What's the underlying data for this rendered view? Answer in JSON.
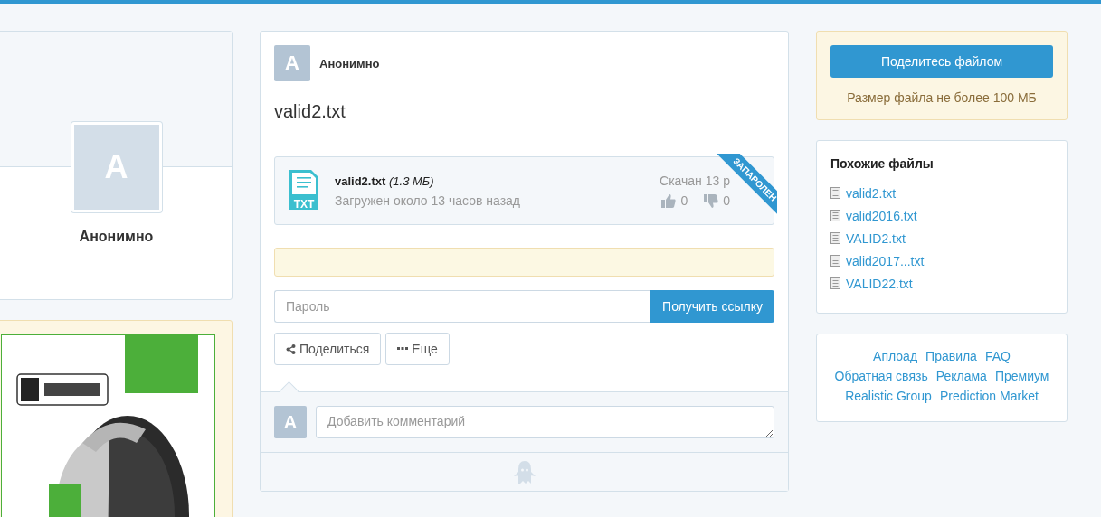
{
  "profile": {
    "avatar_letter": "А",
    "name": "Анонимно"
  },
  "post": {
    "author_letter": "А",
    "author": "Анонимно",
    "title": "valid2.txt",
    "file": {
      "icon_label": "TXT",
      "name": "valid2.txt",
      "size": "(1.3 МБ)",
      "uploaded": "Загружен около 13 часов назад",
      "downloads": "Скачан 13 р",
      "likes": "0",
      "dislikes": "0",
      "ribbon": "ЗАПАРОЛЕН"
    },
    "password": {
      "placeholder": "Пароль"
    },
    "get_link": "Получить ссылку",
    "actions": [
      {
        "kind": "share",
        "label": "Поделиться"
      },
      {
        "kind": "more",
        "label": "Еще"
      }
    ],
    "comment": {
      "avatar_letter": "А",
      "placeholder": "Добавить комментарий"
    }
  },
  "upload": {
    "button": "Поделитесь файлом",
    "note": "Размер файла не более 100 МБ"
  },
  "similar": {
    "title": "Похожие файлы",
    "items": [
      "valid2.txt",
      "valid2016.txt",
      "VALID2.txt",
      "valid2017...txt",
      "VALID22.txt"
    ]
  },
  "footer_links": [
    {
      "links": [
        "Аплоад",
        "Правила",
        "FAQ"
      ]
    },
    {
      "links": [
        "Обратная связь",
        "Реклама",
        "Премиум"
      ]
    },
    {
      "links": [
        "Realistic Group",
        "Prediction Market"
      ]
    }
  ]
}
